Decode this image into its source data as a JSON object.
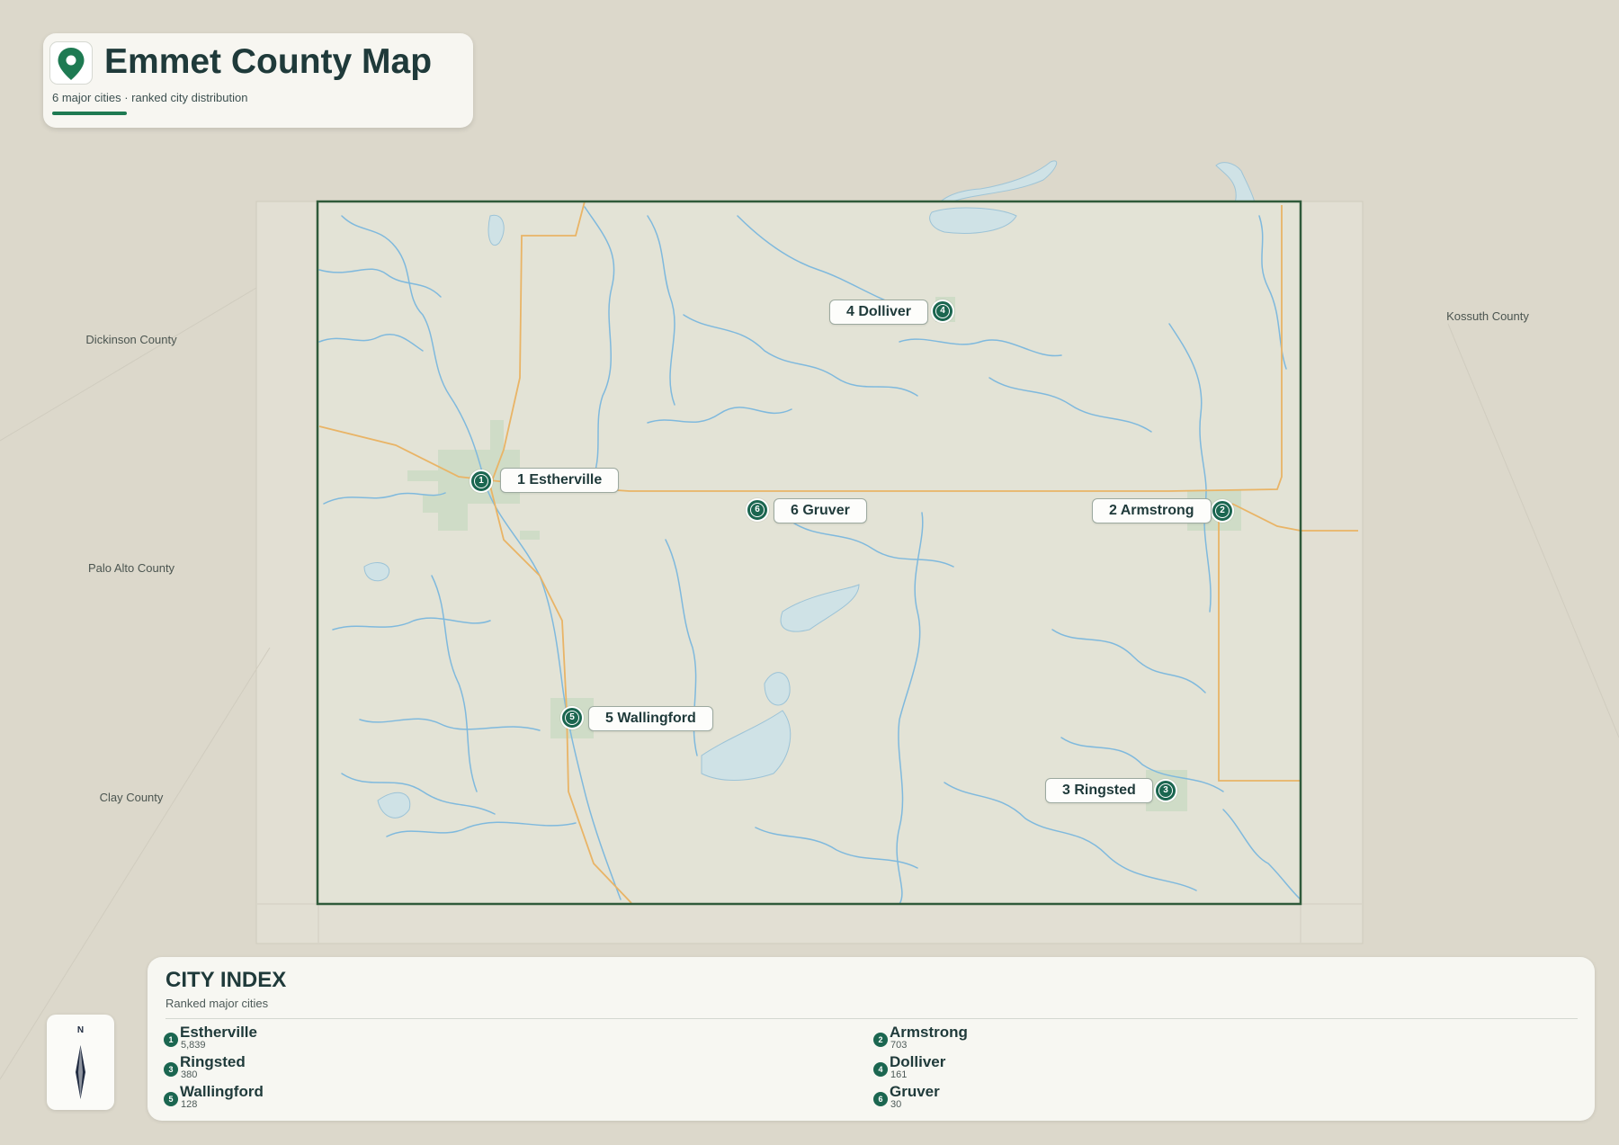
{
  "header": {
    "title": "Emmet County Map",
    "subtitle": "6 major cities · ranked city distribution",
    "icon": "map-pin-icon"
  },
  "neighbors": {
    "dickinson": "Dickinson County",
    "palo_alto": "Palo Alto County",
    "clay": "Clay County",
    "kossuth": "Kossuth County"
  },
  "cities": [
    {
      "rank": "1",
      "label": "1 Estherville",
      "name": "Estherville",
      "population": "5,839"
    },
    {
      "rank": "2",
      "label": "2 Armstrong",
      "name": "Armstrong",
      "population": "703"
    },
    {
      "rank": "3",
      "label": "3 Ringsted",
      "name": "Ringsted",
      "population": "380"
    },
    {
      "rank": "4",
      "label": "4 Dolliver",
      "name": "Dolliver",
      "population": "161"
    },
    {
      "rank": "5",
      "label": "5 Wallingford",
      "name": "Wallingford",
      "population": "128"
    },
    {
      "rank": "6",
      "label": "6 Gruver",
      "name": "Gruver",
      "population": "30"
    }
  ],
  "index": {
    "title": "CITY INDEX",
    "subtitle": "Ranked major cities"
  },
  "compass": {
    "north_label": "N",
    "icon": "compass-arrow-icon"
  },
  "colors": {
    "accent": "#1b6650",
    "county_border": "#2f5a3a",
    "rivers": "#7fb9dd",
    "roads": "#e9b466",
    "land": "#e3e3d6",
    "background": "#dcd8cb"
  }
}
